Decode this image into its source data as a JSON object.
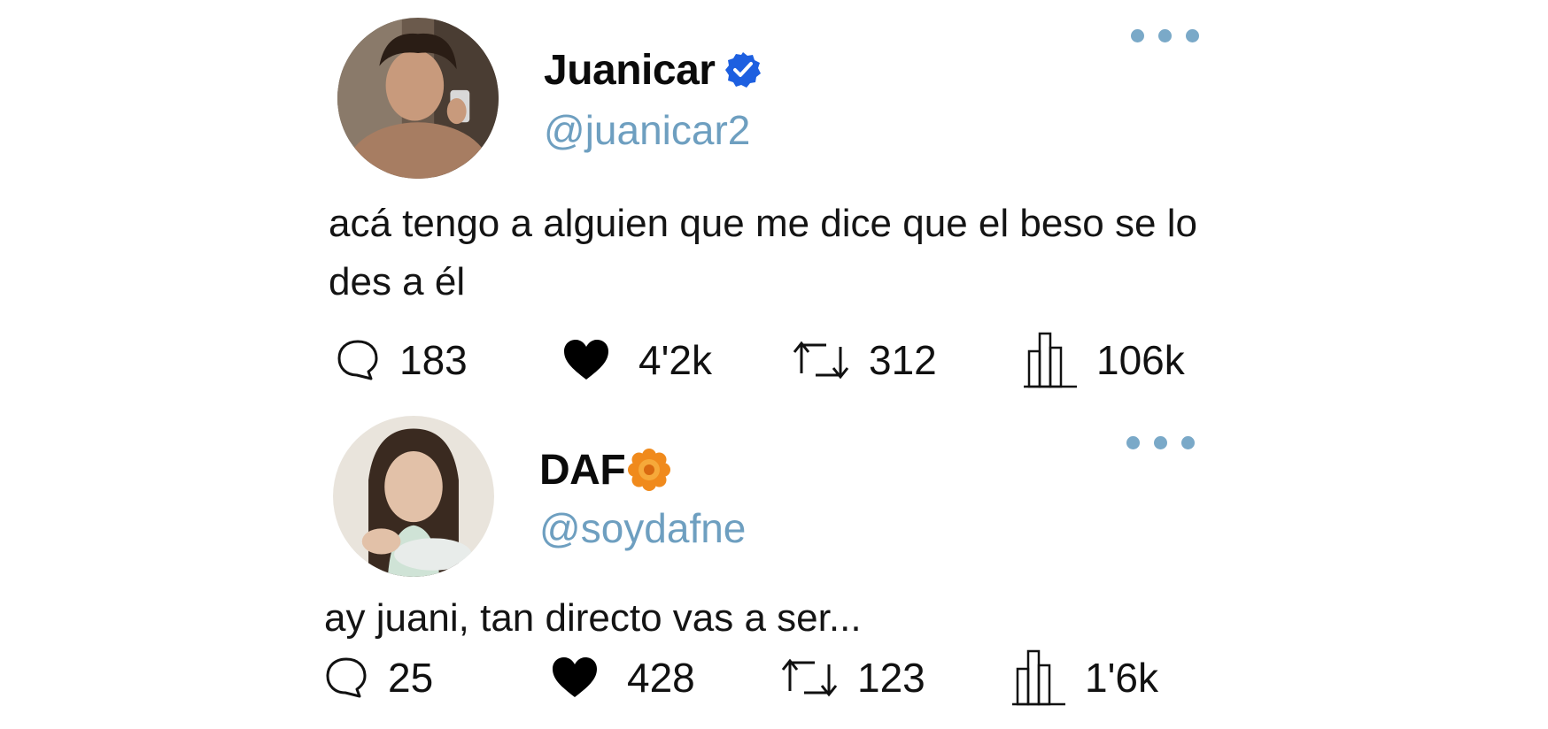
{
  "tweets": [
    {
      "display_name": "Juanicar",
      "handle": "@juanicar2",
      "badge": "verified-check-icon",
      "text": "acá tengo a alguien que me dice que el beso se lo des a él",
      "stats": {
        "replies": "183",
        "likes": "4'2k",
        "retweets": "312",
        "views": "106k"
      }
    },
    {
      "display_name": "DAF",
      "handle": "@soydafne",
      "badge": "orange-flower-badge-icon",
      "text": "ay juani, tan directo vas a ser...",
      "stats": {
        "replies": "25",
        "likes": "428",
        "retweets": "123",
        "views": "1'6k"
      }
    }
  ],
  "colors": {
    "handle": "#6e9fc0",
    "more_dots": "#7aa9c8",
    "verified": "#1d5fe0",
    "flower_badge": "#f08a1c"
  }
}
